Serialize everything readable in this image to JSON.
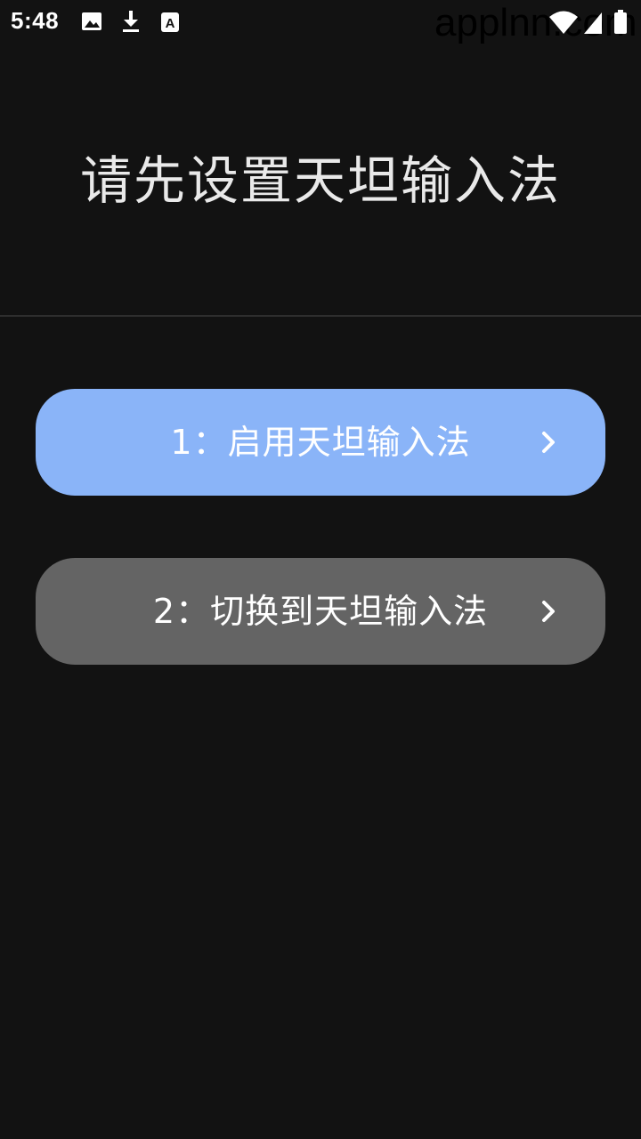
{
  "status_bar": {
    "time": "5:48",
    "icons": [
      "image-icon",
      "download-icon",
      "a-notification-icon",
      "wifi-icon",
      "signal-icon",
      "battery-icon"
    ],
    "watermark": "applnn.com"
  },
  "page": {
    "title": "请先设置天坦输入法"
  },
  "steps": [
    {
      "label": "1：启用天坦输入法",
      "color": "#8ab4f8",
      "icon": "chevron-right-icon"
    },
    {
      "label": "2：切换到天坦输入法",
      "color": "#646464",
      "icon": "chevron-right-icon"
    }
  ],
  "colors": {
    "background": "#121212",
    "divider": "#2e2e2e",
    "title": "#e9e9e9"
  }
}
